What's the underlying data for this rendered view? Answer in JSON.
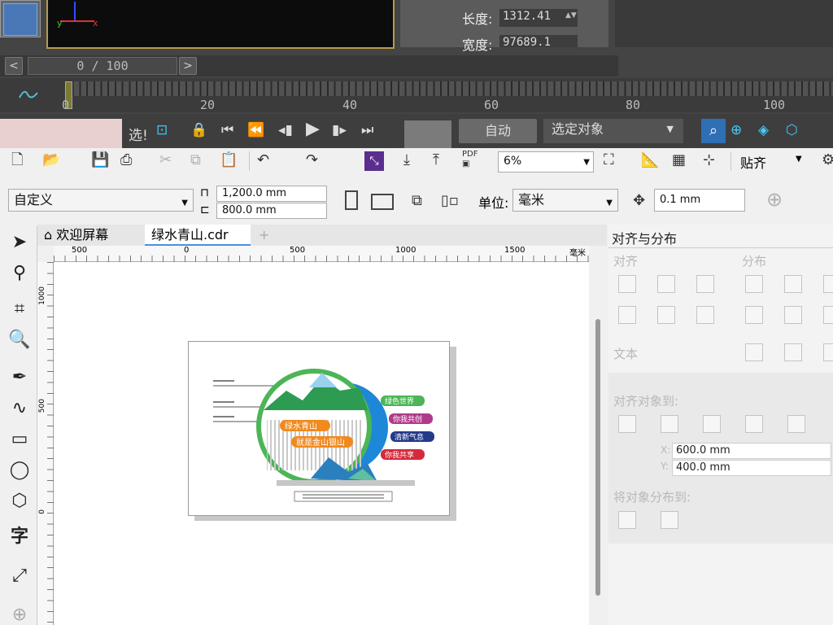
{
  "props": {
    "length_label": "长度:",
    "length_value": "1312.41",
    "width_label": "宽度:",
    "width_value": "97689.1"
  },
  "timeslider": {
    "frame": "0 / 100",
    "prev": "<",
    "next": ">"
  },
  "timeline": {
    "ticks": [
      "0",
      "20",
      "40",
      "60",
      "80",
      "100"
    ]
  },
  "controls": {
    "select_label": "选!",
    "auto": "自动",
    "selected_object": "选定对象"
  },
  "toolbar": {
    "zoom": "6%",
    "snap": "贴齐"
  },
  "propbar": {
    "preset": "自定义",
    "width": "1,200.0 mm",
    "height": "800.0 mm",
    "units_label": "单位:",
    "units": "毫米",
    "nudge": "0.1 mm"
  },
  "tabs": {
    "welcome": "欢迎屏幕",
    "doc": "绿水青山.cdr"
  },
  "ruler": {
    "h": [
      "500",
      "0",
      "500",
      "1000",
      "1500"
    ],
    "unit": "毫米",
    "v": [
      "1000",
      "500",
      "0"
    ]
  },
  "art": {
    "tag1": "绿色世界",
    "tag2": "你我共创",
    "tag3": "清新气息",
    "tag4": "你我共享",
    "title1": "绿水青山",
    "title2": "就是金山银山"
  },
  "panel": {
    "title": "对齐与分布",
    "align": "对齐",
    "distribute": "分布",
    "text": "文本",
    "align_to": "对齐对象到:",
    "x": "600.0 mm",
    "y": "400.0 mm",
    "x_label": "X:",
    "y_label": "Y:",
    "distribute_to": "将对象分布到:"
  },
  "colors": {
    "accent_green": "#4cb556",
    "accent_blue": "#1e88d8",
    "orange": "#f08a1e"
  }
}
